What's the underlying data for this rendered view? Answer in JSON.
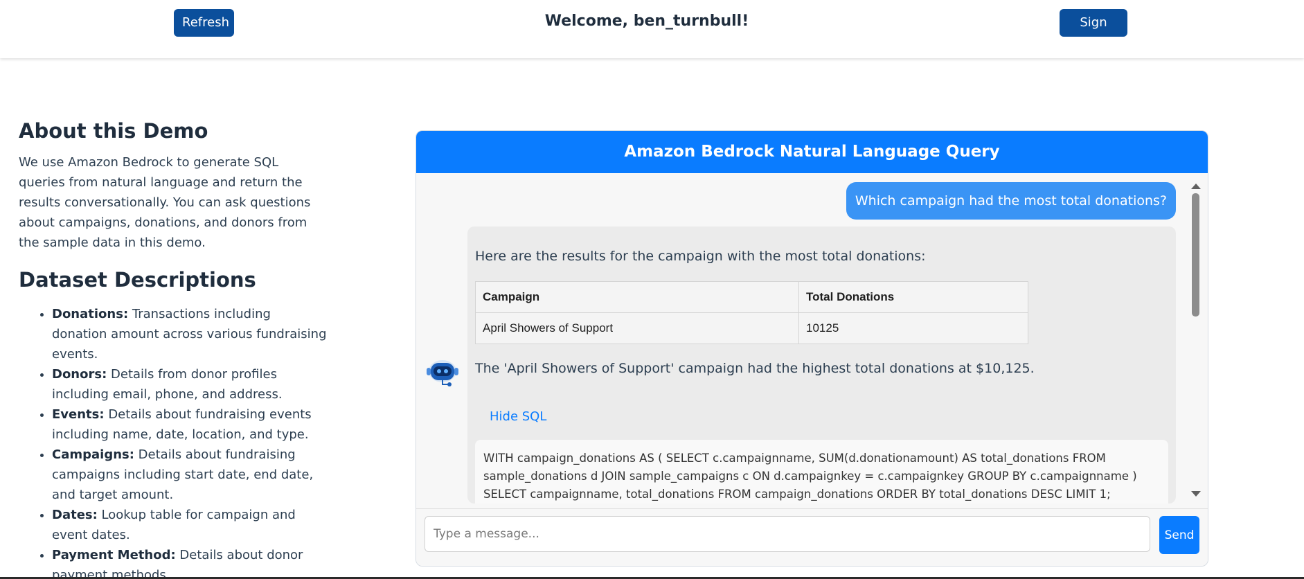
{
  "header": {
    "refresh_label": "Refresh",
    "welcome_text": "Welcome, ben_turnbull!",
    "signout_label": "Sign Out"
  },
  "sidebar": {
    "about_title": "About this Demo",
    "about_text": "We use Amazon Bedrock to generate SQL queries from natural language and return the results conversationally. You can ask questions about campaigns, donations, and donors from the sample data in this demo.",
    "datasets_title": "Dataset Descriptions",
    "datasets": [
      {
        "name": "Donations:",
        "desc": "Transactions including donation amount across various fundraising events."
      },
      {
        "name": "Donors:",
        "desc": "Details from donor profiles including email, phone, and address."
      },
      {
        "name": "Events:",
        "desc": "Details about fundraising events including name, date, location, and type."
      },
      {
        "name": "Campaigns:",
        "desc": "Details about fundraising campaigns including start date, end date, and target amount."
      },
      {
        "name": "Dates:",
        "desc": "Lookup table for campaign and event dates."
      },
      {
        "name": "Payment Method:",
        "desc": "Details about donor payment methods."
      }
    ]
  },
  "chat": {
    "title": "Amazon Bedrock Natural Language Query",
    "user_message": "Which campaign had the most total donations?",
    "bot_intro": "Here are the results for the campaign with the most total donations:",
    "table": {
      "headers": [
        "Campaign",
        "Total Donations"
      ],
      "rows": [
        [
          "April Showers of Support",
          "10125"
        ]
      ]
    },
    "bot_summary": "The 'April Showers of Support' campaign had the highest total donations at $10,125.",
    "hide_sql_label": "Hide SQL",
    "sql_text": "WITH campaign_donations AS ( SELECT c.campaignname, SUM(d.donationamount) AS total_donations FROM sample_donations d JOIN sample_campaigns c ON d.campaignkey = c.campaignkey GROUP BY c.campaignname ) SELECT campaignname, total_donations FROM campaign_donations ORDER BY total_donations DESC LIMIT 1;",
    "input_placeholder": "Type a message...",
    "send_label": "Send",
    "avatar_icon": "robot-icon"
  },
  "colors": {
    "primary_dark": "#0b4f9c",
    "accent_blue": "#0a7cff",
    "user_bubble": "#3a94f5"
  }
}
